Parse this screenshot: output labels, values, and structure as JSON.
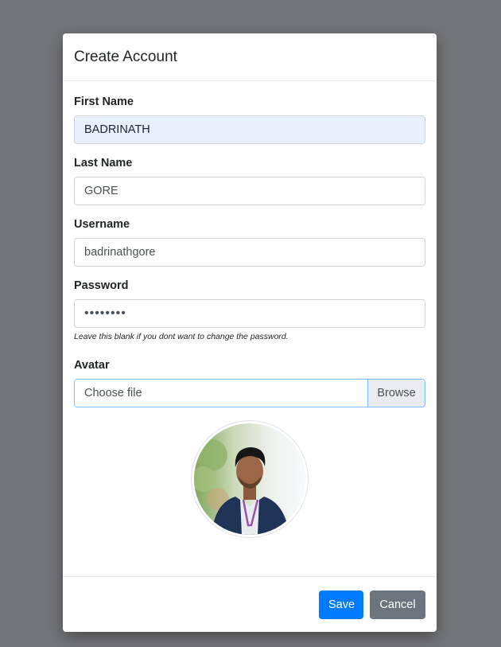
{
  "modal": {
    "title": "Create Account"
  },
  "form": {
    "first_name": {
      "label": "First Name",
      "value": "BADRINATH"
    },
    "last_name": {
      "label": "Last Name",
      "value": "GORE"
    },
    "username": {
      "label": "Username",
      "value": "badrinathgore"
    },
    "password": {
      "label": "Password",
      "value": "••••••••",
      "help": "Leave this blank if you dont want to change the password."
    },
    "avatar": {
      "label": "Avatar",
      "file_placeholder": "Choose file",
      "browse_label": "Browse"
    }
  },
  "footer": {
    "save_label": "Save",
    "cancel_label": "Cancel"
  },
  "colors": {
    "overlay": "#737476",
    "primary": "#007bff",
    "secondary": "#6c757d",
    "autofill": "#e8f0fe",
    "focus_border": "#80bdff"
  }
}
